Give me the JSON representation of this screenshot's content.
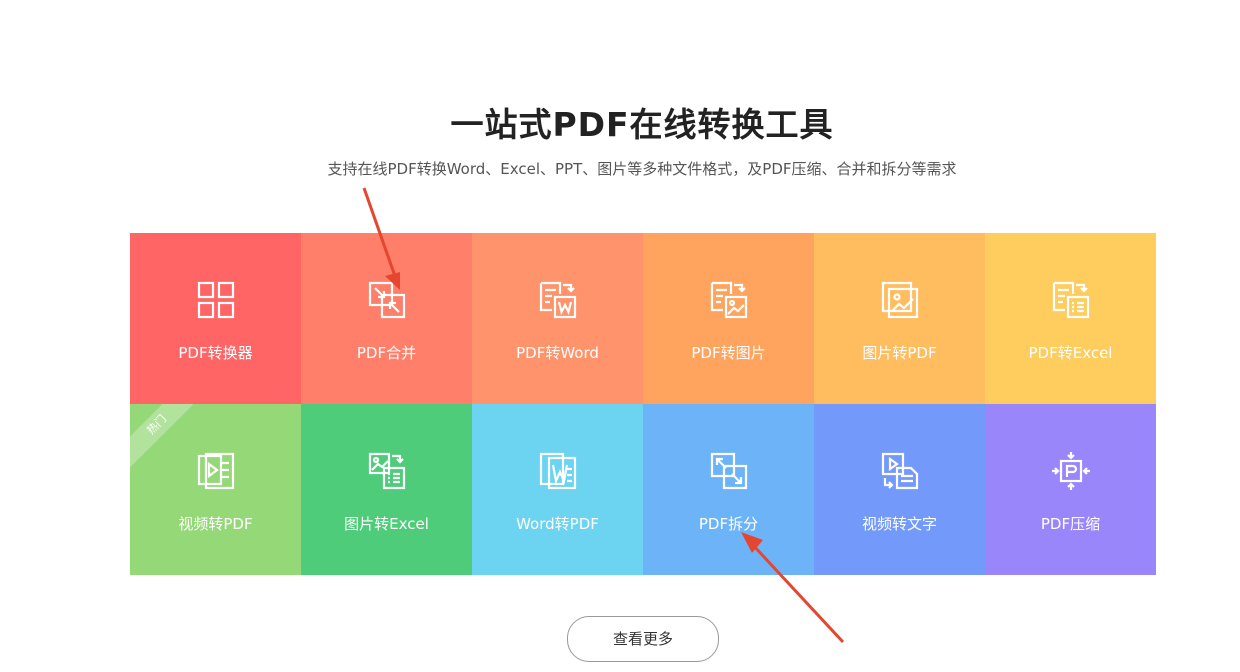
{
  "header": {
    "title": "一站式PDF在线转换工具",
    "subtitle": "支持在线PDF转换Word、Excel、PPT、图片等多种文件格式，及PDF压缩、合并和拆分等需求"
  },
  "tiles": [
    {
      "label": "PDF转换器",
      "icon": "grid-icon",
      "color": "#ff6565"
    },
    {
      "label": "PDF合并",
      "icon": "merge-icon",
      "color": "#ff7f6a"
    },
    {
      "label": "PDF转Word",
      "icon": "pdf-to-word-icon",
      "color": "#ff936b"
    },
    {
      "label": "PDF转图片",
      "icon": "pdf-to-image-icon",
      "color": "#ffa45f"
    },
    {
      "label": "图片转PDF",
      "icon": "image-to-pdf-icon",
      "color": "#ffbd60"
    },
    {
      "label": "PDF转Excel",
      "icon": "pdf-to-excel-icon",
      "color": "#ffcc5e"
    },
    {
      "label": "视频转PDF",
      "icon": "video-to-pdf-icon",
      "color": "#95d878",
      "badge": "热门"
    },
    {
      "label": "图片转Excel",
      "icon": "image-to-excel-icon",
      "color": "#4fcc7a"
    },
    {
      "label": "Word转PDF",
      "icon": "word-to-pdf-icon",
      "color": "#6cd3f0"
    },
    {
      "label": "PDF拆分",
      "icon": "split-icon",
      "color": "#6cb4f7"
    },
    {
      "label": "视频转文字",
      "icon": "video-to-text-icon",
      "color": "#7399fb"
    },
    {
      "label": "PDF压缩",
      "icon": "compress-icon",
      "color": "#9a86fb"
    }
  ],
  "more_button": {
    "label": "查看更多"
  },
  "annotations": {
    "arrow_color": "#e5462f"
  }
}
